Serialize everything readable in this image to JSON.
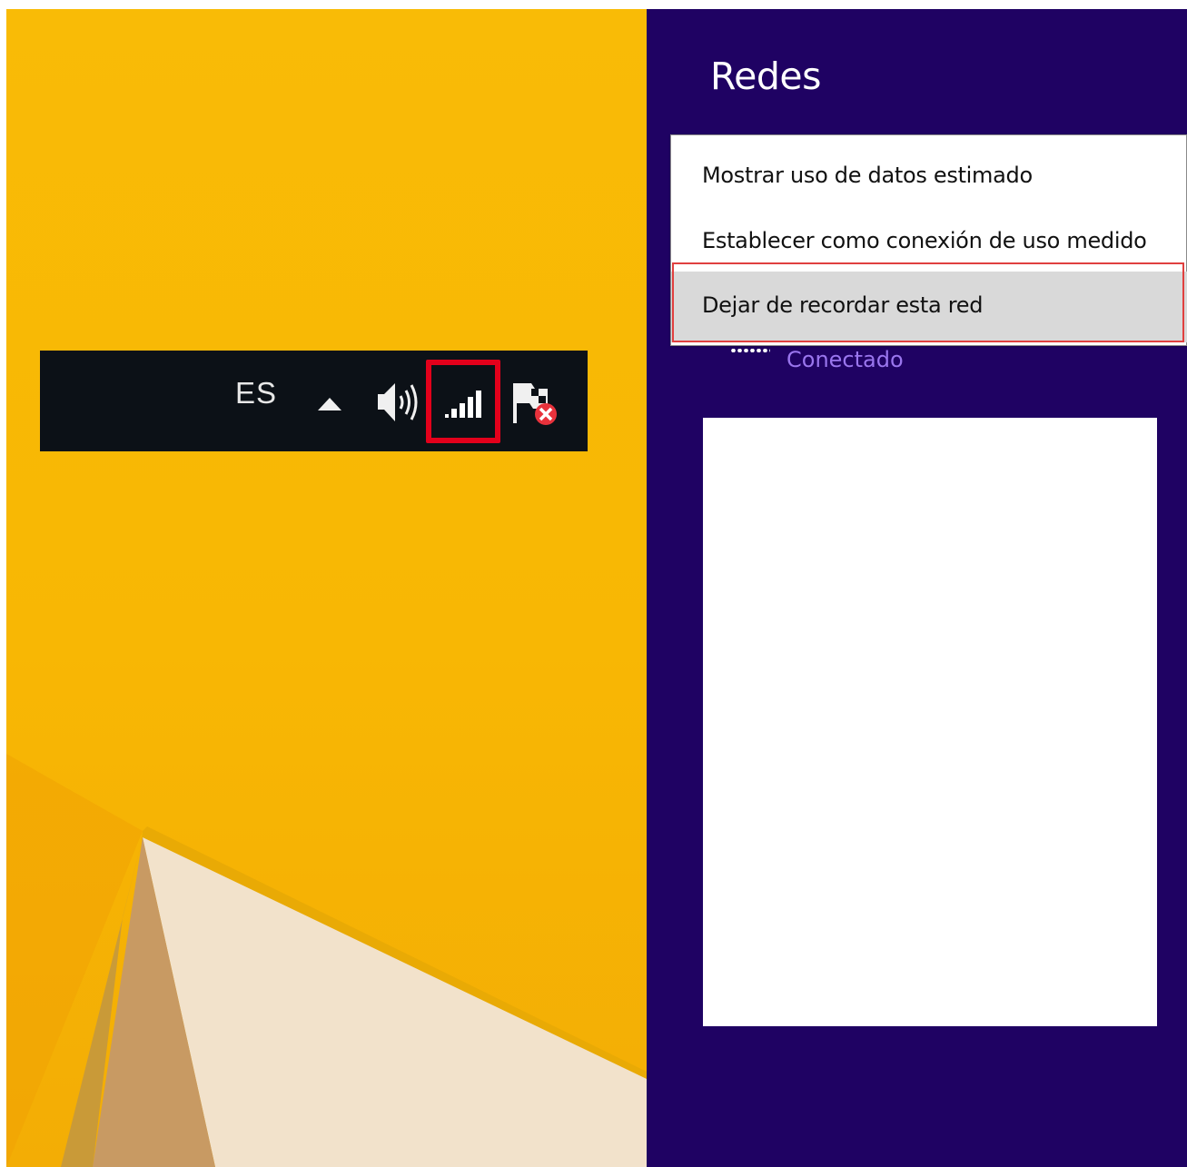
{
  "taskbar": {
    "language": "ES",
    "tray_icons": [
      "show-hidden-icons-arrow",
      "volume-icon",
      "network-signal-icon",
      "action-center-flag-icon"
    ],
    "highlight_color": "#e3001b"
  },
  "networks_panel": {
    "title": "Redes",
    "connection_status": "Conectado",
    "background_color": "#1f0263",
    "status_color": "#9a76ee"
  },
  "context_menu": {
    "items": [
      {
        "label": "Mostrar uso de datos estimado",
        "highlighted": false
      },
      {
        "label": "Establecer como conexión de uso medido",
        "highlighted": false
      },
      {
        "label": "Dejar de recordar esta red",
        "highlighted": true
      }
    ],
    "highlight_color": "#e0403f"
  },
  "wallpaper": {
    "color": "#f9bb06"
  }
}
